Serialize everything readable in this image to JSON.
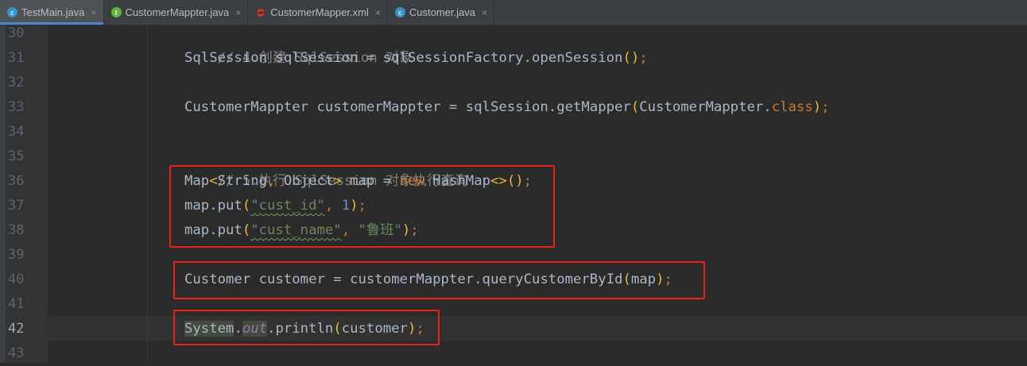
{
  "tabs": [
    {
      "label": "TestMain.java",
      "icon": "class-icon",
      "active": true
    },
    {
      "label": "CustomerMappter.java",
      "icon": "interface-icon",
      "active": false
    },
    {
      "label": "CustomerMapper.xml",
      "icon": "xml-icon",
      "active": false
    },
    {
      "label": "Customer.java",
      "icon": "class-icon",
      "active": false
    }
  ],
  "tab_close_glyph": "×",
  "line_numbers": [
    "30",
    "31",
    "32",
    "33",
    "34",
    "35",
    "36",
    "37",
    "38",
    "39",
    "40",
    "41",
    "42",
    "43"
  ],
  "code": {
    "l30": "// 4.创建 SqlSession 对象",
    "l31_a": "SqlSession sqlSession = sqlSessionFactory.openSession",
    "l33_a": "CustomerMappter customerMappter = sqlSession.getMapper",
    "l33_b": "CustomerMappter.",
    "l33_c": "class",
    "l35": "// 5.执行 SqlSession 对象执行查询",
    "l36_a": "Map",
    "l36_b": "String",
    "l36_c": " Object",
    "l36_d": " map = ",
    "l36_e": "new",
    "l36_f": " HashMap",
    "l37_a": "map.put",
    "l37_str": "\"cust_id\"",
    "l37_num": "1",
    "l38_a": "map.put",
    "l38_str1": "\"cust_name\"",
    "l38_str2": "\"鲁班\"",
    "l40_a": "Customer customer = customerMappter.queryCustomerById",
    "l40_b": "map",
    "l42_a": "System",
    "l42_b": ".",
    "l42_c": "out",
    "l42_d": ".println",
    "l42_e": "customer"
  },
  "colors": {
    "background": "#2b2b2b",
    "comment": "#808080",
    "keyword": "#cc7832",
    "string": "#6a8759",
    "number": "#6897bb",
    "static_field": "#9876aa",
    "annotation_box": "#e9211c"
  }
}
